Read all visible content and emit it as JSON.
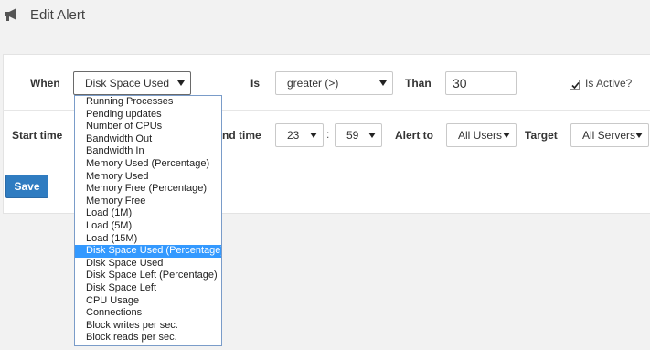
{
  "header": {
    "title": "Edit Alert",
    "icon": "megaphone-icon"
  },
  "row1": {
    "when_label": "When",
    "metric_value": "Disk Space Used",
    "is_label": "Is",
    "operator_value": "greater (>)",
    "than_label": "Than",
    "threshold_value": "30",
    "active_label": "Is Active?",
    "active_checked": true
  },
  "row2": {
    "start_label": "Start time",
    "end_label": "nd time",
    "end_hour": "23",
    "colon": ":",
    "end_minute": "59",
    "alert_to_label": "Alert to",
    "alert_to_value": "All Users",
    "target_label": "Target",
    "target_value": "All Servers"
  },
  "actions": {
    "save_label": "Save"
  },
  "dropdown": {
    "options": [
      "Running Processes",
      "Pending updates",
      "Number of CPUs",
      "Bandwidth Out",
      "Bandwidth In",
      "Memory Used (Percentage)",
      "Memory Used",
      "Memory Free (Percentage)",
      "Memory Free",
      "Load (1M)",
      "Load (5M)",
      "Load (15M)",
      "Disk Space Used (Percentage)",
      "Disk Space Used",
      "Disk Space Left (Percentage)",
      "Disk Space Left",
      "CPU Usage",
      "Connections",
      "Block writes per sec.",
      "Block reads per sec."
    ],
    "highlighted": "Disk Space Used (Percentage)"
  },
  "colors": {
    "accent": "#2f7cc1",
    "highlight": "#3399ff"
  }
}
